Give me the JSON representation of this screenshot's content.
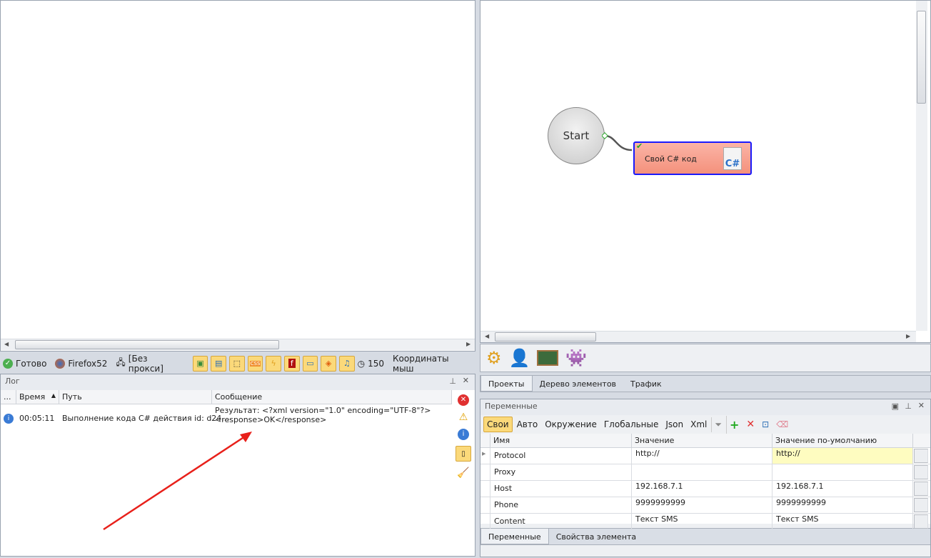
{
  "status": {
    "ready": "Готово",
    "browser": "Firefox52",
    "proxy": "[Без прокси]",
    "timer": "150",
    "coords": "Координаты мыш"
  },
  "log": {
    "title": "Лог",
    "columns": [
      "...",
      "Время",
      "Путь",
      "Сообщение"
    ],
    "rows": [
      {
        "time": "00:05:11",
        "path": "Выполнение кода C# действия id: d24...",
        "message_line1": "Результат: <?xml version=\"1.0\" encoding=\"UTF-8\"?>",
        "message_line2": "<response>OK</response>"
      }
    ]
  },
  "canvas": {
    "start_label": "Start",
    "node_label": "Свой C# код"
  },
  "project_tabs": [
    "Проекты",
    "Дерево элементов",
    "Трафик"
  ],
  "variables": {
    "title": "Переменные",
    "filters": [
      "Свои",
      "Авто",
      "Окружение",
      "Глобальные",
      "Json",
      "Xml"
    ],
    "columns": [
      "Имя",
      "Значение",
      "Значение по-умолчанию"
    ],
    "rows": [
      {
        "name": "Protocol",
        "value": "http://",
        "default": "http://"
      },
      {
        "name": "Proxy",
        "value": "",
        "default": ""
      },
      {
        "name": "Host",
        "value": "192.168.7.1",
        "default": "192.168.7.1"
      },
      {
        "name": "Phone",
        "value": "9999999999",
        "default": "9999999999"
      },
      {
        "name": "Content",
        "value": "Текст SMS",
        "default": "Текст SMS"
      }
    ]
  },
  "bottom_tabs": [
    "Переменные",
    "Свойства элемента"
  ],
  "colors": {
    "accent": "#fbd97a",
    "node": "#f79a86",
    "node_border": "#1a1aff",
    "arrow": "#e8201a"
  }
}
